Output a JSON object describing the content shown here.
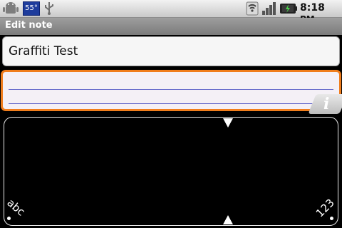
{
  "status_bar": {
    "temperature": "55°",
    "time": "8:18",
    "time_suffix": "PM",
    "icons": [
      "android-icon",
      "weather-icon",
      "usb-icon",
      "wifi-icon",
      "signal-icon",
      "battery-icon"
    ]
  },
  "header": {
    "title": "Edit note"
  },
  "note": {
    "title": "Graffiti Test",
    "body": ""
  },
  "info_button": {
    "glyph": "i"
  },
  "graffiti": {
    "left_corner": "abc",
    "right_corner": "123"
  },
  "colors": {
    "focus": "#f07d1c",
    "rule": "#5a5fc8",
    "weather": "#1e3c9c"
  }
}
